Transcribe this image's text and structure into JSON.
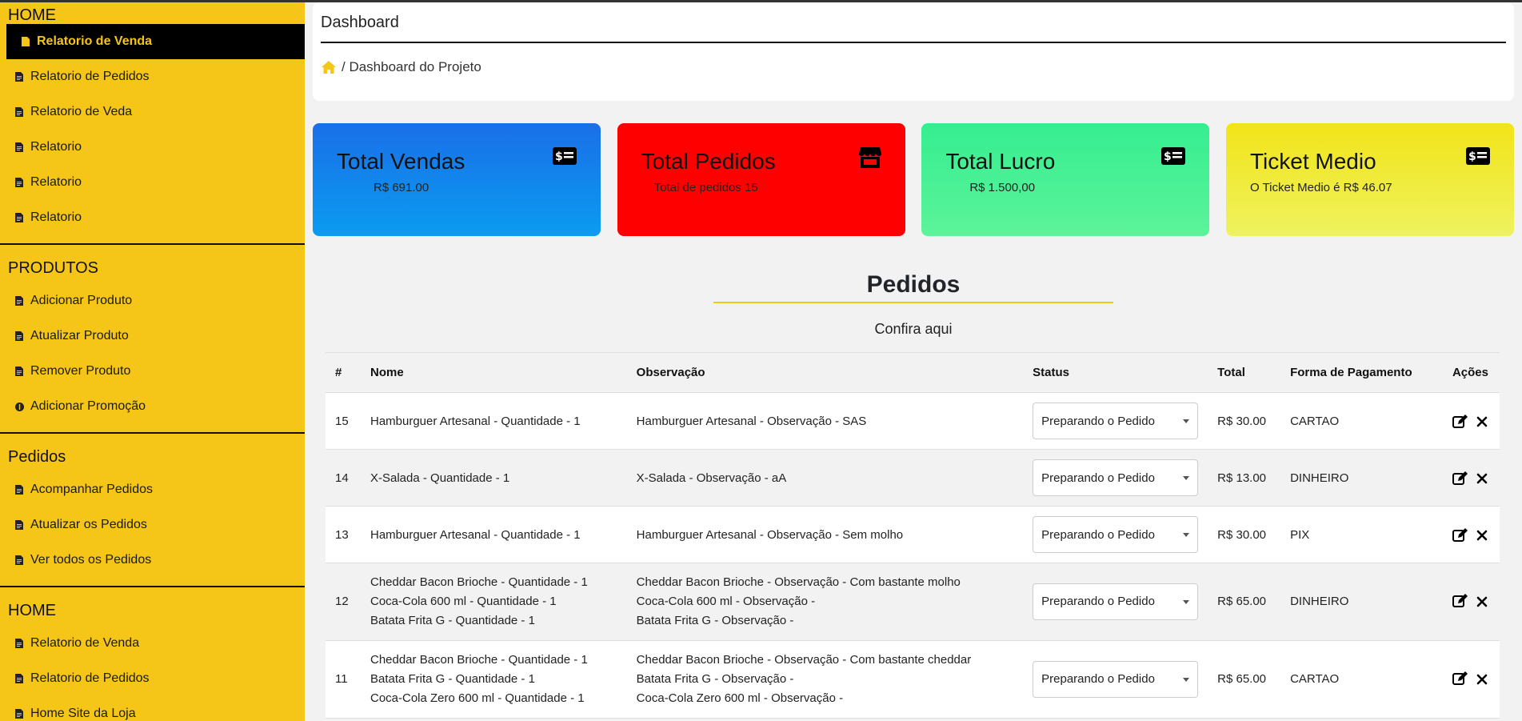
{
  "sidebar": {
    "home_title": "HOME",
    "home_items": [
      {
        "label": "Relatorio de Venda",
        "icon": "file-icon",
        "active": true
      },
      {
        "label": "Relatorio de Pedidos",
        "icon": "file-icon"
      },
      {
        "label": "Relatorio de Veda",
        "icon": "file-icon"
      },
      {
        "label": "Relatorio",
        "icon": "file-icon"
      },
      {
        "label": "Relatorio",
        "icon": "file-icon"
      },
      {
        "label": "Relatorio",
        "icon": "file-icon"
      }
    ],
    "produtos_title": "PRODUTOS",
    "produtos_items": [
      {
        "label": "Adicionar Produto",
        "icon": "file-icon"
      },
      {
        "label": "Atualizar Produto",
        "icon": "file-icon"
      },
      {
        "label": "Remover Produto",
        "icon": "file-icon"
      },
      {
        "label": "Adicionar Promoção",
        "icon": "coin-icon"
      }
    ],
    "pedidos_title": "Pedidos",
    "pedidos_items": [
      {
        "label": "Acompanhar Pedidos",
        "icon": "file-icon"
      },
      {
        "label": "Atualizar os Pedidos",
        "icon": "file-icon"
      },
      {
        "label": "Ver todos os Pedidos",
        "icon": "file-icon"
      }
    ],
    "home2_title": "HOME",
    "home2_items": [
      {
        "label": "Relatorio de Venda",
        "icon": "file-icon"
      },
      {
        "label": "Relatorio de Pedidos",
        "icon": "file-icon"
      },
      {
        "label": "Home Site da Loja",
        "icon": "file-icon"
      }
    ]
  },
  "header": {
    "title": "Dashboard",
    "breadcrumb": "/ Dashboard do Projeto"
  },
  "cards": [
    {
      "title": "Total Vendas",
      "value": "R$ 691.00",
      "icon": "money-icon",
      "color": "#1a6fe8"
    },
    {
      "title": "Total Pedidos",
      "value": "Total de pedidos 15",
      "icon": "store-icon",
      "color": "#ff0000"
    },
    {
      "title": "Total Lucro",
      "value": "R$ 1.500,00",
      "icon": "money-icon",
      "color": "#35ee90"
    },
    {
      "title": "Ticket Medio",
      "value": "O Ticket Medio é R$ 46.07",
      "icon": "money-icon",
      "color": "#f2e419"
    }
  ],
  "section": {
    "title": "Pedidos",
    "subtitle": "Confira aqui"
  },
  "table": {
    "headers": [
      "#",
      "Nome",
      "Observação",
      "Status",
      "Total",
      "Forma de Pagamento",
      "Ações"
    ],
    "rows": [
      {
        "id": "15",
        "nome": [
          "Hamburguer Artesanal - Quantidade - 1"
        ],
        "obs": [
          "Hamburguer Artesanal - Observação - SAS"
        ],
        "status": "Preparando o Pedido",
        "total": "R$ 30.00",
        "pagamento": "CARTAO"
      },
      {
        "id": "14",
        "nome": [
          "X-Salada - Quantidade - 1"
        ],
        "obs": [
          "X-Salada - Observação - aA"
        ],
        "status": "Preparando o Pedido",
        "total": "R$ 13.00",
        "pagamento": "DINHEIRO"
      },
      {
        "id": "13",
        "nome": [
          "Hamburguer Artesanal - Quantidade - 1"
        ],
        "obs": [
          "Hamburguer Artesanal - Observação - Sem molho"
        ],
        "status": "Preparando o Pedido",
        "total": "R$ 30.00",
        "pagamento": "PIX"
      },
      {
        "id": "12",
        "nome": [
          "Cheddar Bacon Brioche - Quantidade - 1",
          "Coca-Cola 600 ml - Quantidade - 1",
          "Batata Frita G - Quantidade - 1"
        ],
        "obs": [
          "Cheddar Bacon Brioche - Observação - Com bastante molho",
          "Coca-Cola 600 ml - Observação -",
          "Batata Frita G - Observação -"
        ],
        "status": "Preparando o Pedido",
        "total": "R$ 65.00",
        "pagamento": "DINHEIRO"
      },
      {
        "id": "11",
        "nome": [
          "Cheddar Bacon Brioche - Quantidade - 1",
          "Batata Frita G - Quantidade - 1",
          "Coca-Cola Zero 600 ml - Quantidade - 1"
        ],
        "obs": [
          "Cheddar Bacon Brioche - Observação - Com bastante cheddar",
          "Batata Frita G - Observação -",
          "Coca-Cola Zero 600 ml - Observação -"
        ],
        "status": "Preparando o Pedido",
        "total": "R$ 65.00",
        "pagamento": "CARTAO"
      }
    ]
  },
  "colors": {
    "sidebar_bg": "#f5c518",
    "accent": "#f5c518",
    "home_icon": "#f5c518"
  }
}
